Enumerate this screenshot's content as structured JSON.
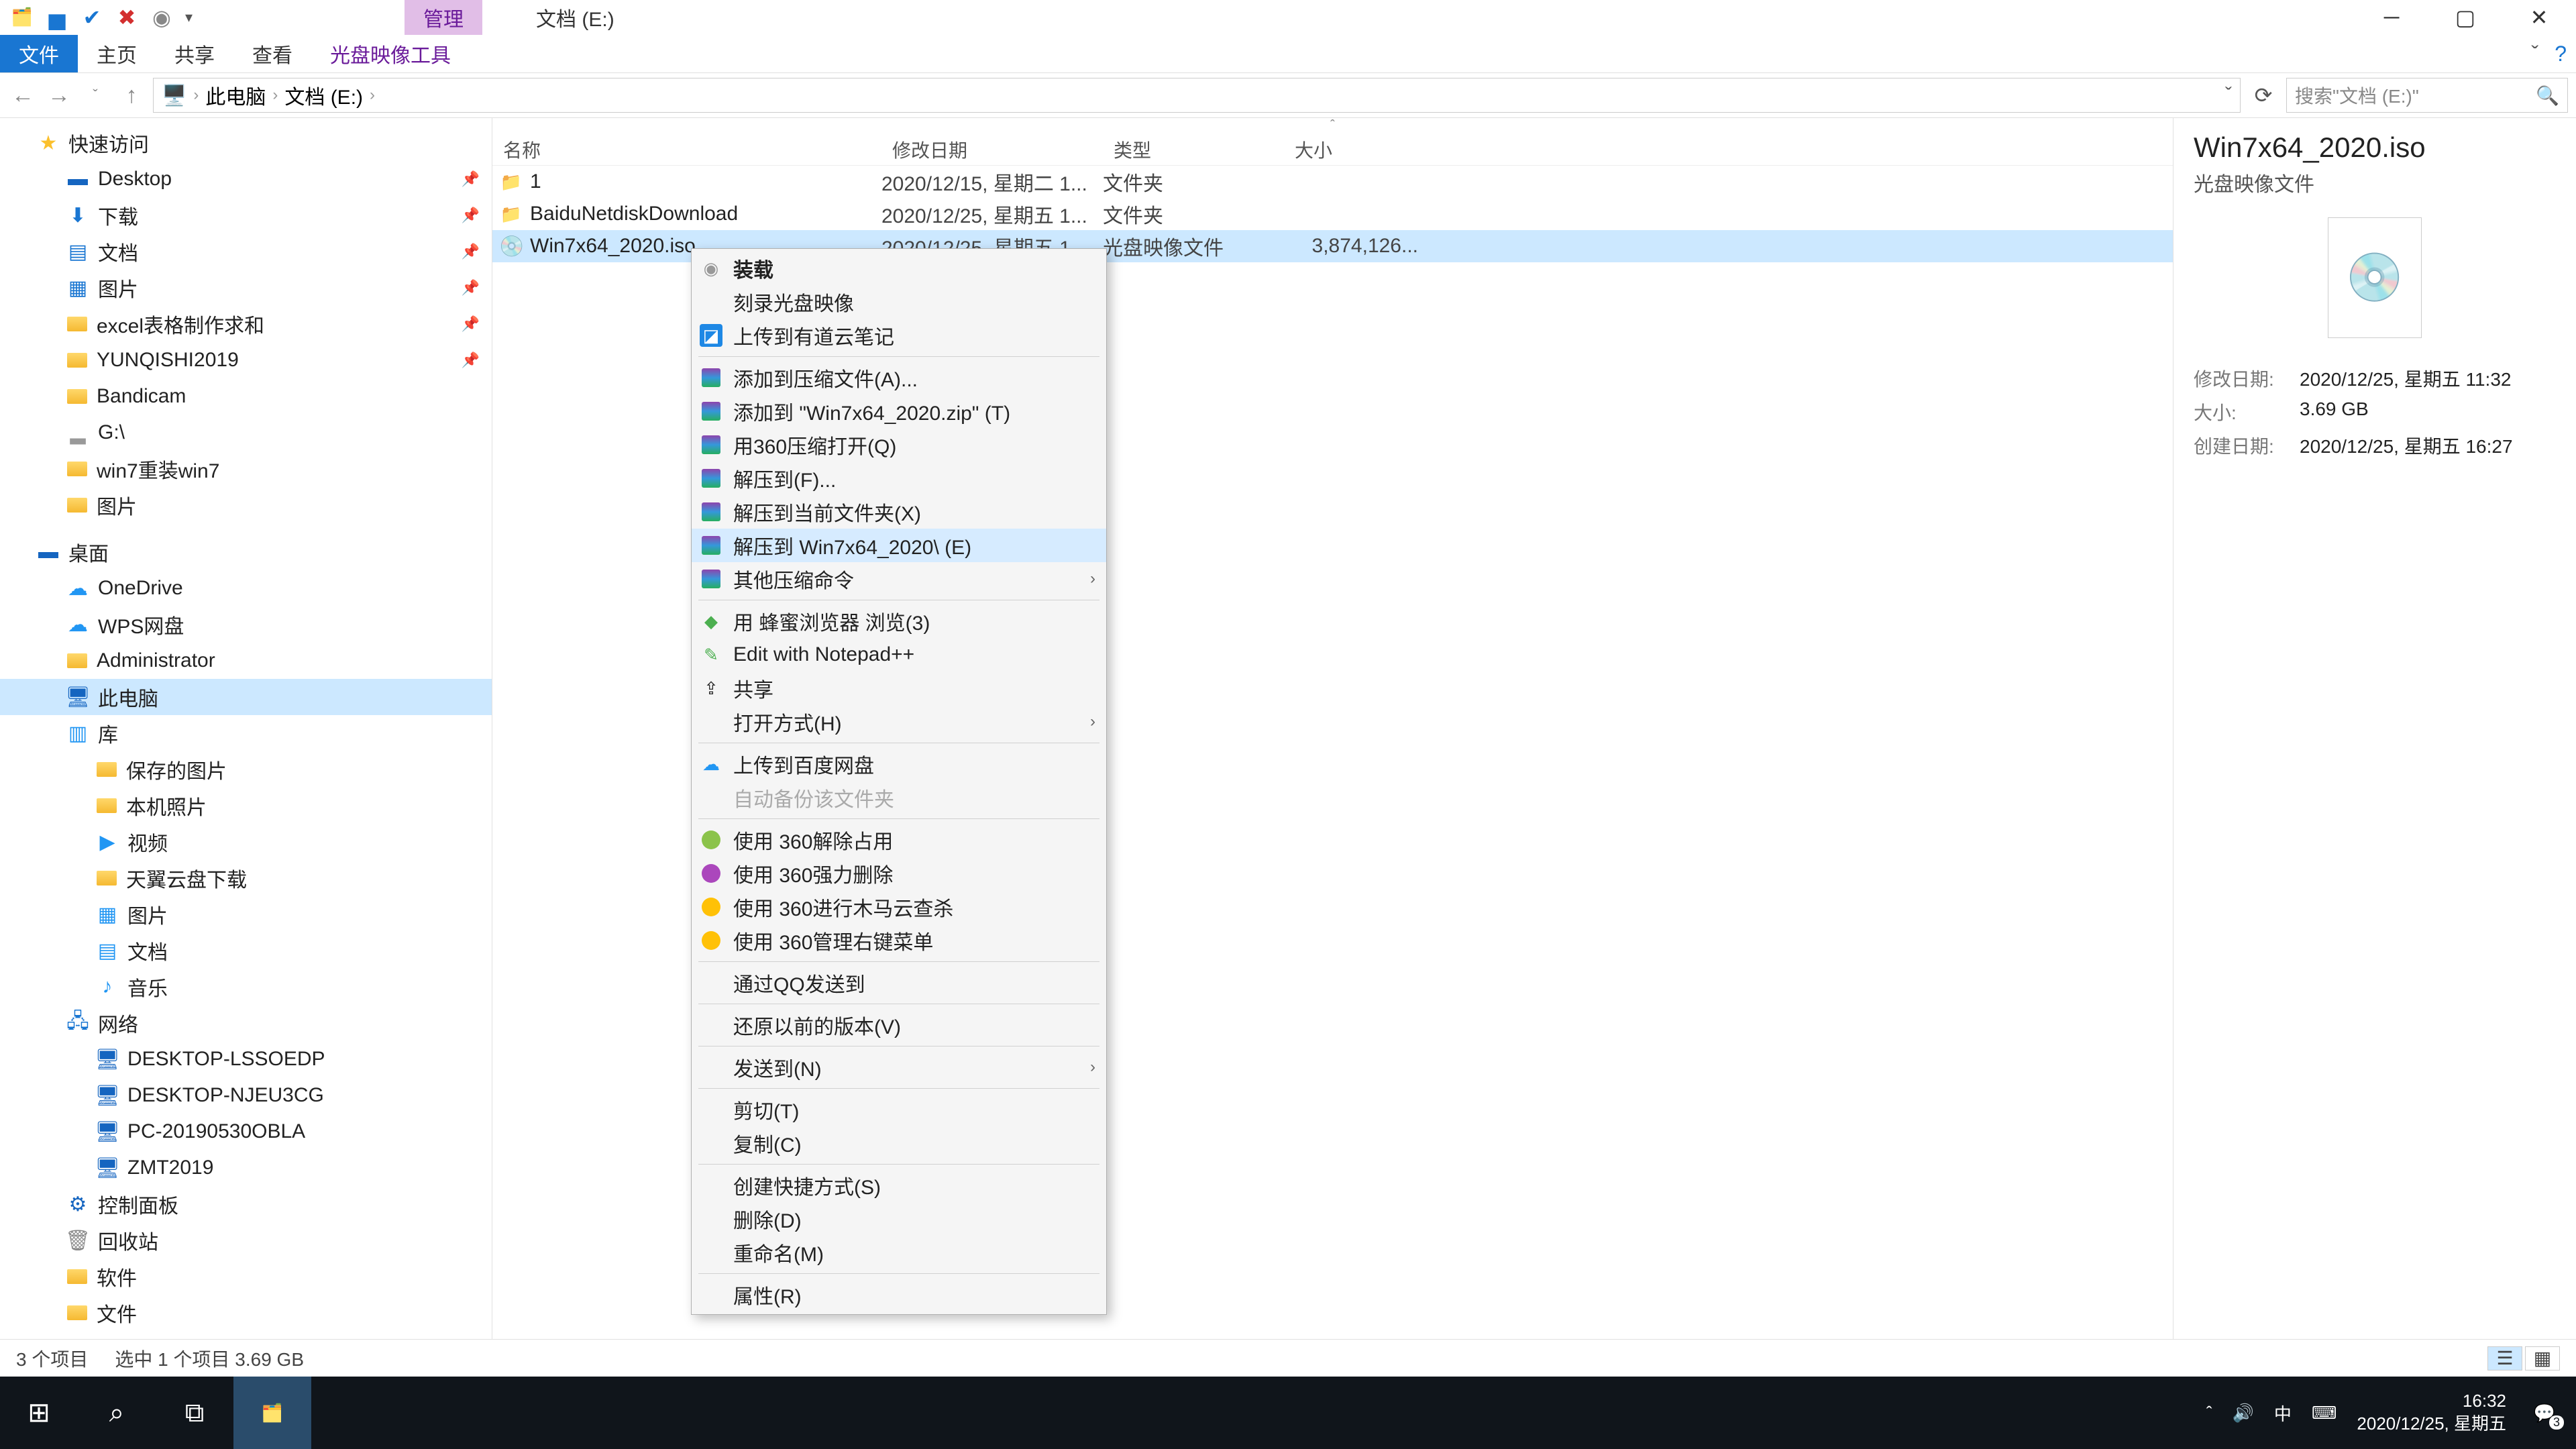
{
  "titlebar": {
    "contextual_tab": "管理",
    "window_title": "文档 (E:)"
  },
  "ribbon": {
    "file": "文件",
    "home": "主页",
    "share": "共享",
    "view": "查看",
    "tool": "光盘映像工具"
  },
  "breadcrumb": {
    "root": "此电脑",
    "current": "文档 (E:)"
  },
  "search": {
    "placeholder": "搜索\"文档 (E:)\""
  },
  "tree": {
    "quick_access": "快速访问",
    "desktop": "Desktop",
    "downloads": "下载",
    "documents": "文档",
    "pictures": "图片",
    "excel": "excel表格制作求和",
    "yunqishi": "YUNQISHI2019",
    "bandicam": "Bandicam",
    "g_drive": "G:\\",
    "win7reinstall": "win7重装win7",
    "pictures2": "图片",
    "desktop_cn": "桌面",
    "onedrive": "OneDrive",
    "wps": "WPS网盘",
    "admin": "Administrator",
    "this_pc": "此电脑",
    "libraries": "库",
    "saved_pics": "保存的图片",
    "camera_roll": "本机照片",
    "videos": "视频",
    "tianyi": "天翼云盘下载",
    "lib_pictures": "图片",
    "lib_documents": "文档",
    "music": "音乐",
    "network": "网络",
    "pc1": "DESKTOP-LSSOEDP",
    "pc2": "DESKTOP-NJEU3CG",
    "pc3": "PC-20190530OBLA",
    "pc4": "ZMT2019",
    "control_panel": "控制面板",
    "recycle": "回收站",
    "software": "软件",
    "files": "文件"
  },
  "columns": {
    "name": "名称",
    "modified": "修改日期",
    "type": "类型",
    "size": "大小"
  },
  "rows": [
    {
      "name": "1",
      "date": "2020/12/15, 星期二 1...",
      "type": "文件夹",
      "size": ""
    },
    {
      "name": "BaiduNetdiskDownload",
      "date": "2020/12/25, 星期五 1...",
      "type": "文件夹",
      "size": ""
    },
    {
      "name": "Win7x64_2020.iso",
      "date": "2020/12/25, 星期五 1...",
      "type": "光盘映像文件",
      "size": "3,874,126..."
    }
  ],
  "context_menu": {
    "mount": "装载",
    "burn": "刻录光盘映像",
    "youdao": "上传到有道云笔记",
    "add_archive": "添加到压缩文件(A)...",
    "add_zip": "添加到 \"Win7x64_2020.zip\" (T)",
    "open_360zip": "用360压缩打开(Q)",
    "extract_to": "解压到(F)...",
    "extract_here": "解压到当前文件夹(X)",
    "extract_named": "解压到 Win7x64_2020\\ (E)",
    "other_zip": "其他压缩命令",
    "honeybrowser": "用 蜂蜜浏览器 浏览(3)",
    "notepad": "Edit with Notepad++",
    "share": "共享",
    "open_with": "打开方式(H)",
    "baidu_upload": "上传到百度网盘",
    "auto_backup": "自动备份该文件夹",
    "unlock360": "使用 360解除占用",
    "force_del360": "使用 360强力删除",
    "scan360": "使用 360进行木马云查杀",
    "manage360": "使用 360管理右键菜单",
    "qq_send": "通过QQ发送到",
    "restore": "还原以前的版本(V)",
    "send_to": "发送到(N)",
    "cut": "剪切(T)",
    "copy": "复制(C)",
    "shortcut": "创建快捷方式(S)",
    "delete": "删除(D)",
    "rename": "重命名(M)",
    "properties": "属性(R)"
  },
  "details": {
    "title": "Win7x64_2020.iso",
    "subtitle": "光盘映像文件",
    "modified_label": "修改日期:",
    "modified": "2020/12/25, 星期五 11:32",
    "size_label": "大小:",
    "size": "3.69 GB",
    "created_label": "创建日期:",
    "created": "2020/12/25, 星期五 16:27"
  },
  "statusbar": {
    "count": "3 个项目",
    "selection": "选中 1 个项目  3.69 GB"
  },
  "taskbar": {
    "time": "16:32",
    "date": "2020/12/25, 星期五",
    "ime": "中",
    "notif_count": "3"
  }
}
